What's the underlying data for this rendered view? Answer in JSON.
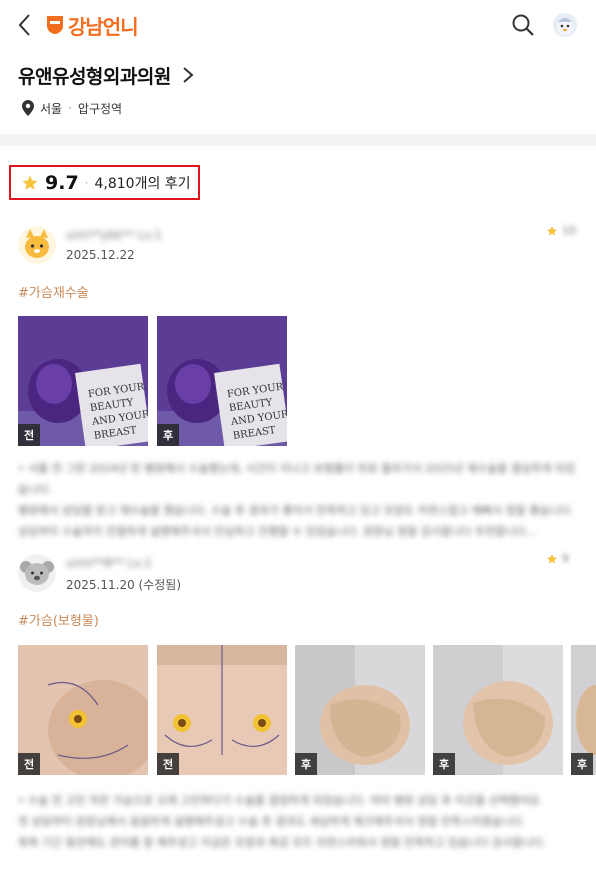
{
  "header": {
    "logo_text": "강남언니",
    "brand_color": "#f26d1e",
    "back_icon": "chevron-left-icon",
    "search_icon": "search-icon",
    "profile_icon": "avatar-icon"
  },
  "clinic": {
    "name": "유앤유성형외과의원",
    "city": "서울",
    "separator": "·",
    "district": "압구정역"
  },
  "rating": {
    "score": "9.7",
    "separator": "·",
    "review_count": "4,810개의 후기",
    "highlight_color": "#e0121b"
  },
  "reviews": [
    {
      "nickname": "unn**ykk** Lv.1",
      "date": "2025.12.22",
      "score": "10",
      "tag": "#가슴재수술",
      "photos": [
        {
          "label": "전",
          "kind": "book"
        },
        {
          "label": "후",
          "kind": "book"
        }
      ],
      "text": [
        "• 서울 전 그런 2024년 한 병원에서 수술했는데, 시간이 지나고 보형물이 위로 올라가서 2025년 재수술을 결심하게 되었습니다.",
        "병원에서 상담을 받고 재수술을 했습니다. 수술 후 경과가 좋아서 만족하고 있고 모양도 자연스럽고 예뻐서 정말 좋습니다.",
        "상담부터 수술까지 친절하게 설명해주셔서 안심하고 진행할 수 있었습니다. 원장님 정말 감사합니다 추천합니다..."
      ]
    },
    {
      "nickname": "unni**8** Lv.1",
      "date": "2025.11.20 (수정됨)",
      "score": "9",
      "tag": "#가슴(보형물)",
      "photos": [
        {
          "label": "전",
          "kind": "skin"
        },
        {
          "label": "전",
          "kind": "skin"
        },
        {
          "label": "후",
          "kind": "bra"
        },
        {
          "label": "후",
          "kind": "bra"
        },
        {
          "label": "후",
          "kind": "bra"
        }
      ],
      "text": [
        "• 수술 전 고민 작은 가슴으로 오래 고민하다가 수술을 결정하게 되었습니다. 여러 병원 상담 후 이곳을 선택했어요.",
        "첫 상담부터 원장님께서 꼼꼼하게 설명해주셨고 수술 후 경과도 세심하게 체크해주셔서 정말 만족스러웠습니다.",
        "회복 기간 동안에도 관리를 잘 해주셨고 지금은 모양과 촉감 모두 자연스러워서 정말 만족하고 있습니다 감사합니다."
      ]
    }
  ]
}
